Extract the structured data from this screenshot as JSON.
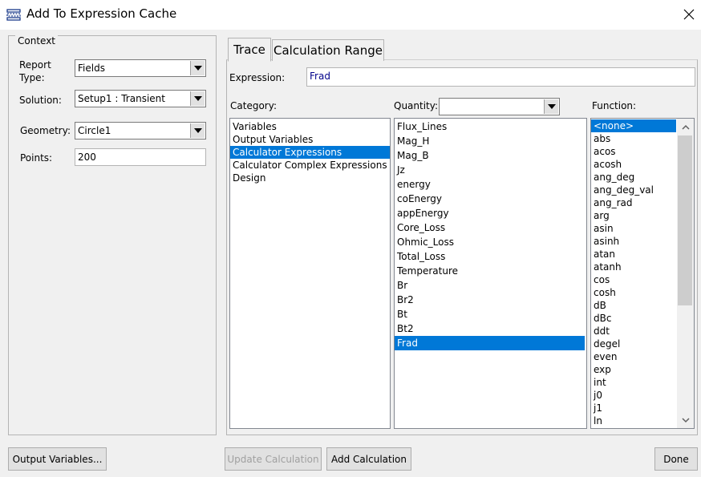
{
  "window": {
    "title": "Add To Expression Cache"
  },
  "context": {
    "legend": "Context",
    "report_type_label_1": "Report",
    "report_type_label_2": "Type:",
    "report_type_value": "Fields",
    "solution_label": "Solution:",
    "solution_value": "Setup1 : Transient",
    "geometry_label": "Geometry:",
    "geometry_value": "Circle1",
    "points_label": "Points:",
    "points_value": "200"
  },
  "tabs": [
    "Trace",
    "Calculation Range"
  ],
  "trace": {
    "expression_label": "Expression:",
    "expression_value": "Frad",
    "category_label": "Category:",
    "categories": [
      "Variables",
      "Output Variables",
      "Calculator Expressions",
      "Calculator Complex Expressions",
      "Design"
    ],
    "category_selected": "Calculator Expressions",
    "quantity_label": "Quantity:",
    "quantity_filter_value": "",
    "quantities": [
      "Flux_Lines",
      "Mag_H",
      "Mag_B",
      "Jz",
      "energy",
      "coEnergy",
      "appEnergy",
      "Core_Loss",
      "Ohmic_Loss",
      "Total_Loss",
      "Temperature",
      "Br",
      "Br2",
      "Bt",
      "Bt2",
      "Frad"
    ],
    "quantity_selected": "Frad",
    "function_label": "Function:",
    "functions": [
      "<none>",
      "abs",
      "acos",
      "acosh",
      "ang_deg",
      "ang_deg_val",
      "ang_rad",
      "arg",
      "asin",
      "asinh",
      "atan",
      "atanh",
      "cos",
      "cosh",
      "dB",
      "dBc",
      "ddt",
      "degel",
      "even",
      "exp",
      "int",
      "j0",
      "j1",
      "ln"
    ],
    "function_selected": "<none>"
  },
  "buttons": {
    "output_variables": "Output Variables...",
    "update_calculation": "Update Calculation",
    "add_calculation": "Add Calculation",
    "done": "Done"
  },
  "colors": {
    "selection": "#0078d7",
    "expression_text": "#00008b"
  }
}
